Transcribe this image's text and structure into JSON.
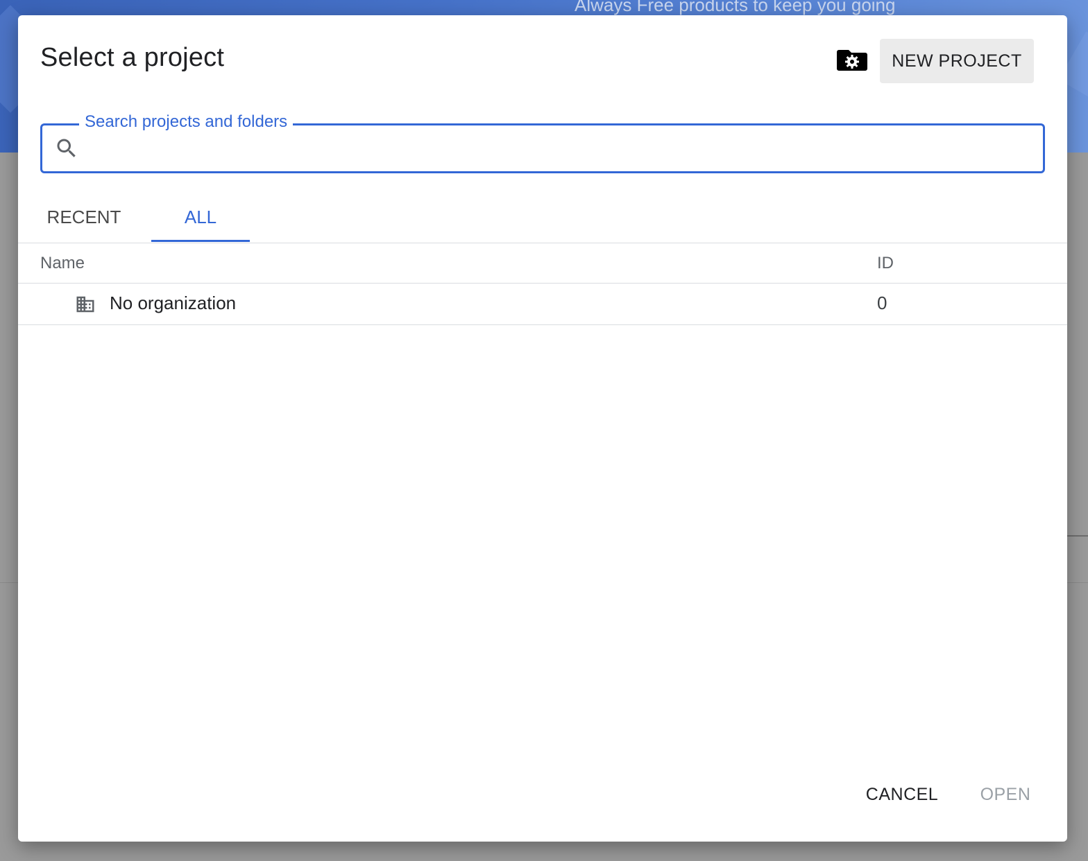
{
  "background": {
    "banner_text": "Always Free products to keep you going",
    "banner_color": "#4672c9",
    "overlay_color": "#9a9a9a"
  },
  "dialog": {
    "title": "Select a project",
    "manage_icon": "folder-gear-icon",
    "new_project_label": "NEW PROJECT",
    "search": {
      "label": "Search projects and folders",
      "value": "",
      "icon": "search-icon"
    },
    "tabs": [
      {
        "label": "RECENT",
        "active": false
      },
      {
        "label": "ALL",
        "active": true
      }
    ],
    "table": {
      "columns": [
        "Name",
        "ID"
      ],
      "rows": [
        {
          "icon": "building-icon",
          "name": "No organization",
          "id": "0"
        }
      ]
    },
    "footer": {
      "cancel_label": "CANCEL",
      "open_label": "OPEN",
      "open_disabled": true
    },
    "accent_color": "#3367d6"
  }
}
